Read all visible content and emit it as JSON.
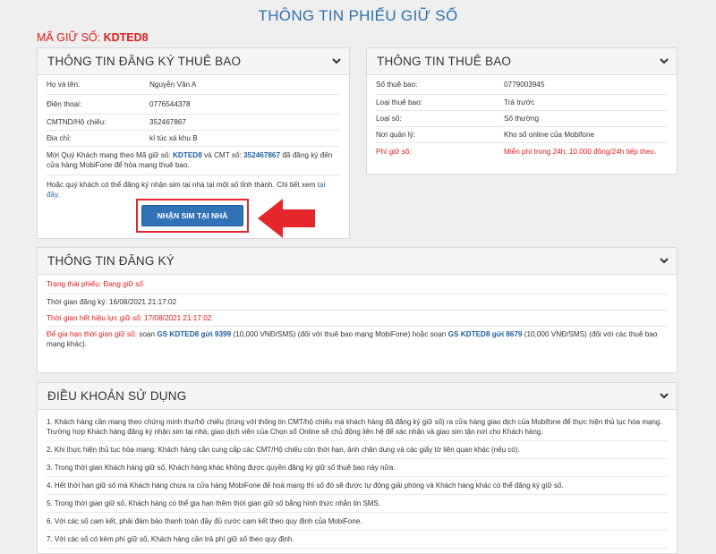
{
  "page": {
    "title": "THÔNG TIN PHIẾU GIỮ SỐ",
    "code_label": "MÃ GIỮ SỐ:",
    "code_value": "KDTED8"
  },
  "subscriber_panel": {
    "title": "THÔNG TIN ĐĂNG KÝ THUÊ BAO",
    "rows": [
      {
        "label": "Họ và tên:",
        "value": "Nguyễn Văn A"
      },
      {
        "label": "Điện thoại:",
        "value": "0776544378"
      },
      {
        "label": "CMTND/Hộ chiếu:",
        "value": "352467867"
      },
      {
        "label": "Địa chỉ:",
        "value": "kí túc xá khu B"
      }
    ],
    "invite_p1": "Mời Quý Khách mang theo Mã giữ số:",
    "invite_code": "KDTED8",
    "invite_p2": "và CMT số:",
    "invite_id": "352467867",
    "invite_p3": "đã đăng ký đến cửa hàng MobiFone để hòa mạng thuê bao.",
    "home_p1": "Hoặc quý khách có thể đăng ký nhận sim tại nhà tại một số tỉnh thành. Chi tiết xem",
    "home_link": "tại đây.",
    "button_label": "NHẬN SIM TẠI NHÀ"
  },
  "number_panel": {
    "title": "THÔNG TIN THUÊ BAO",
    "rows": [
      {
        "label": "Số thuê bao:",
        "value": "0779003945"
      },
      {
        "label": "Loại thuê bao:",
        "value": "Trả trước"
      },
      {
        "label": "Loại số:",
        "value": "Số thường"
      },
      {
        "label": "Nơi quản lý:",
        "value": "Kho số online của Mobifone"
      },
      {
        "label": "Phí giữ số:",
        "value": "Miễn phí trong 24h; 10.000 đồng/24h tiếp theo."
      }
    ]
  },
  "registration_panel": {
    "title": "THÔNG TIN ĐĂNG KÝ",
    "status": "Trạng thái phiếu: Đang giữ số",
    "registered_time": "Thời gian đăng ký: 16/08/2021 21:17:02",
    "expiry_time": "Thời gian hết hiệu lực giữ số: 17/08/2021 21:17:02",
    "extend_label": "Để gia hạn thời gian giữ số:",
    "extend_p1": "soạn",
    "sms1": "GS KDTED8 gửi 9399",
    "extend_p2": "(10,000 VNĐ/SMS) (đối với thuê bao mạng MobiFone) hoặc soạn",
    "sms2": "GS KDTED8 gửi 8679",
    "extend_p3": "(10,000 VNĐ/SMS) (đối với các thuê bao mạng khác)."
  },
  "terms_panel": {
    "title": "ĐIỀU KHOẢN SỬ DỤNG",
    "items": [
      "1. Khách hàng cần mang theo chứng minh thư/hộ chiếu (trùng với thông tin CMT/hộ chiếu mà khách hàng đã đăng ký giữ số) ra cửa hàng giao dịch của Mobifone để thực hiện thủ tục hòa mạng. Trường hợp Khách hàng đăng ký nhận sim tại nhà, giao dịch viên của Chọn số Online sẽ chủ động liên hệ để xác nhận và giao sim tận nơi cho Khách hàng.",
      "2. Khi thực hiện thủ tục hòa mạng: Khách hàng cần cung cấp các CMT/Hộ chiếu còn thời hạn, ảnh chân dung và các giấy tờ liên quan khác (nếu có).",
      "3. Trong thời gian Khách hàng giữ số, Khách hàng khác không được quyền đăng ký giữ số thuê bao này nữa.",
      "4. Hết thời hạn giữ số mà Khách hàng chưa ra cửa hàng MobiFone để hoà mạng thì số đó sẽ được tự động giải phóng và Khách hàng khác có thể đăng ký giữ số.",
      "5. Trong thời gian giữ số, Khách hàng có thể gia hạn thêm thời gian giữ số bằng hình thức nhắn tin SMS.",
      "6. Với các số cam kết, phải đảm bảo thanh toán đầy đủ cước cam kết theo quy định của MobiFone.",
      "7. Với các số có kèm phí giữ số, Khách hàng cần trả phí giữ số theo quy định."
    ]
  },
  "icons": {
    "chevron": "chevron-down-icon",
    "arrow": "arrow-left-icon"
  },
  "colors": {
    "title_blue": "#2f6fad",
    "red": "#e01b1b",
    "button_blue": "#3273b8",
    "arrow_red": "#e5262b"
  }
}
